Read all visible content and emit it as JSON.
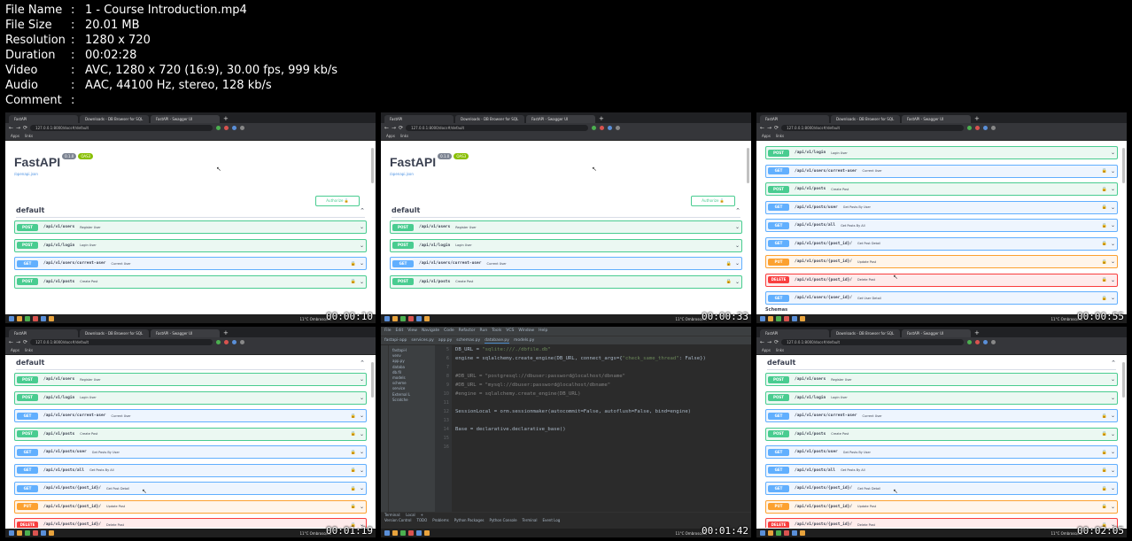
{
  "file_info": [
    {
      "key": "File Name",
      "value": "1 - Course Introduction.mp4"
    },
    {
      "key": "File Size",
      "value": "20.01 MB"
    },
    {
      "key": "Resolution",
      "value": "1280 x 720"
    },
    {
      "key": "Duration",
      "value": "00:02:28"
    },
    {
      "key": "Video",
      "value": "AVC, 1280 x 720 (16:9), 30.00 fps, 999 kb/s"
    },
    {
      "key": "Audio",
      "value": "AAC, 44100 Hz, stereo, 128 kb/s"
    },
    {
      "key": "Comment",
      "value": ""
    }
  ],
  "separator": ":",
  "browser": {
    "tabs": [
      "FastAPI",
      "Downloads - DB Browser for SQL",
      "FastAPI - Swagger UI"
    ],
    "new_tab": "+",
    "url": "127.0.0.1:8000/docs#/default",
    "bookmarks": [
      "Apps",
      "links"
    ]
  },
  "swagger": {
    "title": "FastAPI",
    "version_badge": "0.1.0",
    "oas_badge": "OAS3",
    "openapi_link": "/openapi.json",
    "authorize_label": "Authorize",
    "section": "default",
    "schemas_label": "Schemas",
    "lock_icon": "lock-icon"
  },
  "op_sets": {
    "first": [
      {
        "method": "POST",
        "path": "/api/v1/users",
        "summary": "Register User"
      },
      {
        "method": "POST",
        "path": "/api/v1/login",
        "summary": "Login User"
      },
      {
        "method": "GET",
        "path": "/api/v1/users/current-user",
        "summary": "Current User"
      },
      {
        "method": "POST",
        "path": "/api/v1/posts",
        "summary": "Create Post"
      }
    ],
    "scrolled": [
      {
        "method": "POST",
        "path": "/api/v1/login",
        "summary": "Login User"
      },
      {
        "method": "GET",
        "path": "/api/v1/users/current-user",
        "summary": "Current User"
      },
      {
        "method": "POST",
        "path": "/api/v1/posts",
        "summary": "Create Post"
      },
      {
        "method": "GET",
        "path": "/api/v1/posts/user",
        "summary": "Get Posts By User"
      },
      {
        "method": "GET",
        "path": "/api/v1/posts/all",
        "summary": "Get Posts By All"
      },
      {
        "method": "GET",
        "path": "/api/v1/posts/{post_id}/",
        "summary": "Get Post Detail"
      },
      {
        "method": "PUT",
        "path": "/api/v1/posts/{post_id}/",
        "summary": "Update Post"
      },
      {
        "method": "DELETE",
        "path": "/api/v1/posts/{post_id}/",
        "summary": "Delete Post"
      },
      {
        "method": "GET",
        "path": "/api/v1/users/{user_id}/",
        "summary": "Get User Detail"
      }
    ],
    "full": [
      {
        "method": "POST",
        "path": "/api/v1/users",
        "summary": "Register User"
      },
      {
        "method": "POST",
        "path": "/api/v1/login",
        "summary": "Login User"
      },
      {
        "method": "GET",
        "path": "/api/v1/users/current-user",
        "summary": "Current User"
      },
      {
        "method": "POST",
        "path": "/api/v1/posts",
        "summary": "Create Post"
      },
      {
        "method": "GET",
        "path": "/api/v1/posts/user",
        "summary": "Get Posts By User"
      },
      {
        "method": "GET",
        "path": "/api/v1/posts/all",
        "summary": "Get Posts By All"
      },
      {
        "method": "GET",
        "path": "/api/v1/posts/{post_id}/",
        "summary": "Get Post Detail"
      },
      {
        "method": "PUT",
        "path": "/api/v1/posts/{post_id}/",
        "summary": "Update Post"
      },
      {
        "method": "DELETE",
        "path": "/api/v1/posts/{post_id}/",
        "summary": "Delete Post"
      }
    ]
  },
  "taskbar": {
    "weather": "11°C  Ombroso/ict"
  },
  "thumbnails": [
    {
      "timestamp": "00:00:10",
      "kind": "swagger",
      "header": true,
      "ops": "first"
    },
    {
      "timestamp": "00:00:33",
      "kind": "swagger",
      "header": true,
      "ops": "first"
    },
    {
      "timestamp": "00:00:55",
      "kind": "swagger",
      "header": false,
      "ops": "scrolled"
    },
    {
      "timestamp": "00:01:19",
      "kind": "swagger",
      "header": false,
      "ops": "full"
    },
    {
      "timestamp": "00:01:42",
      "kind": "ide"
    },
    {
      "timestamp": "00:02:05",
      "kind": "swagger",
      "header": false,
      "ops": "full"
    }
  ],
  "ide": {
    "menu": [
      "File",
      "Edit",
      "View",
      "Navigate",
      "Code",
      "Refactor",
      "Run",
      "Tools",
      "VCS",
      "Window",
      "Help"
    ],
    "project": "fastapi-app",
    "file_tabs": [
      "services.py",
      "app.py",
      "schemas.py",
      "database.py",
      "models.py"
    ],
    "active_tab": "database.py",
    "tree": [
      "fastapi-I",
      "venv",
      "app.py",
      "databa",
      "db.fil",
      "models",
      "scheme",
      "service",
      "External L",
      "Scratche"
    ],
    "line_numbers": [
      "5",
      "6",
      "7",
      "8",
      "9",
      "10",
      "11",
      "12",
      "13",
      "14",
      "15",
      "16"
    ],
    "code": [
      "DB_URL = \"sqlite:///./dbfile.db\"",
      "engine = sqlalchemy.create_engine(DB_URL, connect_args={\"check_same_thread\": False})",
      "",
      "#DB_URL = \"postgresql://dbuser:password@localhost/dbname\"",
      "#DB_URL = \"mysql://dbuser:password@localhost/dbname\"",
      "#engine = sqlalchemy.create_engine(DB_URL)",
      "",
      "SessionLocal = orm.sessionmaker(autocommit=False, autoflush=False, bind=engine)",
      "",
      "Base = declarative.declarative_base()",
      "",
      ""
    ],
    "terminal_tabs": [
      "Terminal:",
      "Local",
      "+"
    ],
    "bottom_tools": [
      "Version Control",
      "TODO",
      "Problems",
      "Python Packages",
      "Python Console",
      "Terminal",
      "Event Log"
    ],
    "status": "Packages installed successfully: Installed packages: 'python-multipart' (today 19:03)",
    "status_right": "11:1  CRLF  UTF-8  4 spaces  Python 3.9"
  }
}
